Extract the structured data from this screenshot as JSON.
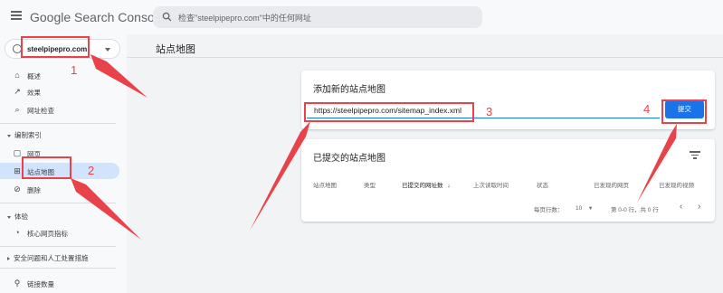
{
  "app": {
    "logo_text": "Google Search Console"
  },
  "search": {
    "placeholder": "检查\"steelpipepro.com\"中的任何网址"
  },
  "property": {
    "name": "steelpipepro.com"
  },
  "sidebar": {
    "items": [
      {
        "label": "概述",
        "icon": "home-icon"
      },
      {
        "label": "效果",
        "icon": "trending-up-icon"
      },
      {
        "label": "网址检查",
        "icon": "search-icon"
      }
    ],
    "sections": {
      "indexing": "编制索引",
      "experience": "体验",
      "security": "安全问题和人工处置措施"
    },
    "indexing_items": [
      {
        "label": "网页",
        "icon": "page-icon"
      },
      {
        "label": "站点地图",
        "icon": "sitemap-icon"
      },
      {
        "label": "删除",
        "icon": "eye-off-icon"
      }
    ],
    "experience_items": [
      {
        "label": "核心网页指标",
        "icon": "gauge-icon"
      }
    ],
    "bottom_items": [
      {
        "label": "链接数量",
        "icon": "links-icon"
      }
    ]
  },
  "page": {
    "title": "站点地图"
  },
  "add_sitemap": {
    "header": "添加新的站点地图",
    "input_value": "https://steelpipepro.com/sitemap_index.xml",
    "submit_label": "提交"
  },
  "submitted": {
    "header": "已提交的站点地图",
    "columns": [
      "站点地图",
      "类型",
      "已提交的网址数",
      "上次读取时间",
      "状态",
      "已发现的网页",
      "已发现的视频"
    ],
    "sort_arrow": "↓",
    "rows_per_page_label": "每页行数：",
    "rows_per_page_value": "10",
    "range_text": "第 0-0 行，共 0 行",
    "prev": "‹",
    "next": "›"
  },
  "annotations": {
    "n1": "1",
    "n2": "2",
    "n3": "3",
    "n4": "4",
    "color": "#e8424b"
  },
  "colors": {
    "accent": "#1a73e8",
    "active_bg": "#d2e3fc"
  }
}
